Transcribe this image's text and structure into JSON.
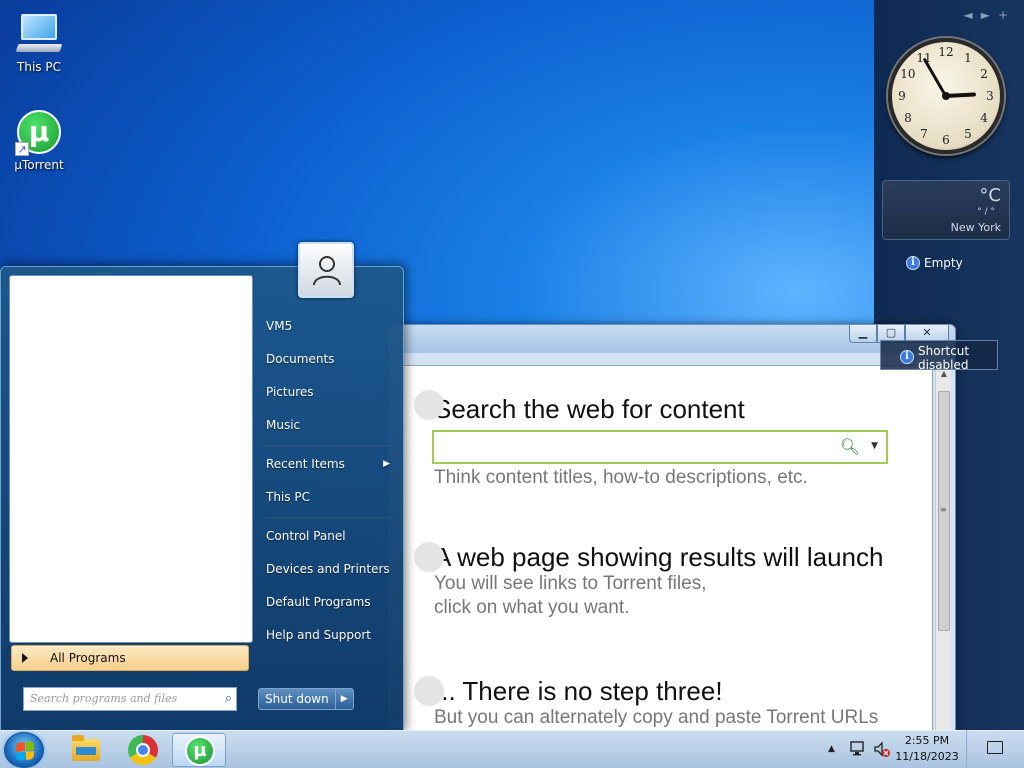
{
  "desktop": {
    "icons": [
      {
        "label": "This PC",
        "icon": "computer-icon"
      },
      {
        "label": "µTorrent",
        "icon": "utorrent-icon"
      }
    ]
  },
  "gadgets": {
    "controls": {
      "prev": "◄",
      "next": "►",
      "add": "+"
    },
    "clock": {
      "numbers": [
        "12",
        "1",
        "2",
        "3",
        "4",
        "5",
        "6",
        "7",
        "8",
        "9",
        "10",
        "11"
      ],
      "time": "2:55"
    },
    "weather": {
      "unit": "°C",
      "range": "° / °",
      "city": "New York"
    },
    "notes": {
      "empty": "Empty",
      "shortcut": "Shortcut disabled"
    }
  },
  "window": {
    "steps": [
      {
        "title": "Search the web for content",
        "text": [
          "Think content titles, how-to descriptions, etc."
        ]
      },
      {
        "title": "A web page showing results will launch",
        "text": [
          "You will see links to Torrent files,",
          "click on what you want."
        ]
      },
      {
        "title": "... There is no step three!",
        "text": [
          "But you can alternately copy and paste Torrent URLs"
        ]
      }
    ]
  },
  "start_menu": {
    "right_items": [
      "VM5",
      "Documents",
      "Pictures",
      "Music",
      "Recent Items",
      "This PC",
      "Control Panel",
      "Devices and Printers",
      "Default Programs",
      "Help and Support"
    ],
    "all_programs": "All Programs",
    "search_placeholder": "Search programs and files",
    "shutdown": "Shut down"
  },
  "taskbar": {
    "apps": [
      "file-explorer",
      "google-chrome",
      "utorrent"
    ],
    "time": "2:55 PM",
    "date": "11/18/2023"
  },
  "colors": {
    "accent": "#1f5fd0",
    "taskbar": "#bcd3ec",
    "start_menu": "#1c588c"
  }
}
